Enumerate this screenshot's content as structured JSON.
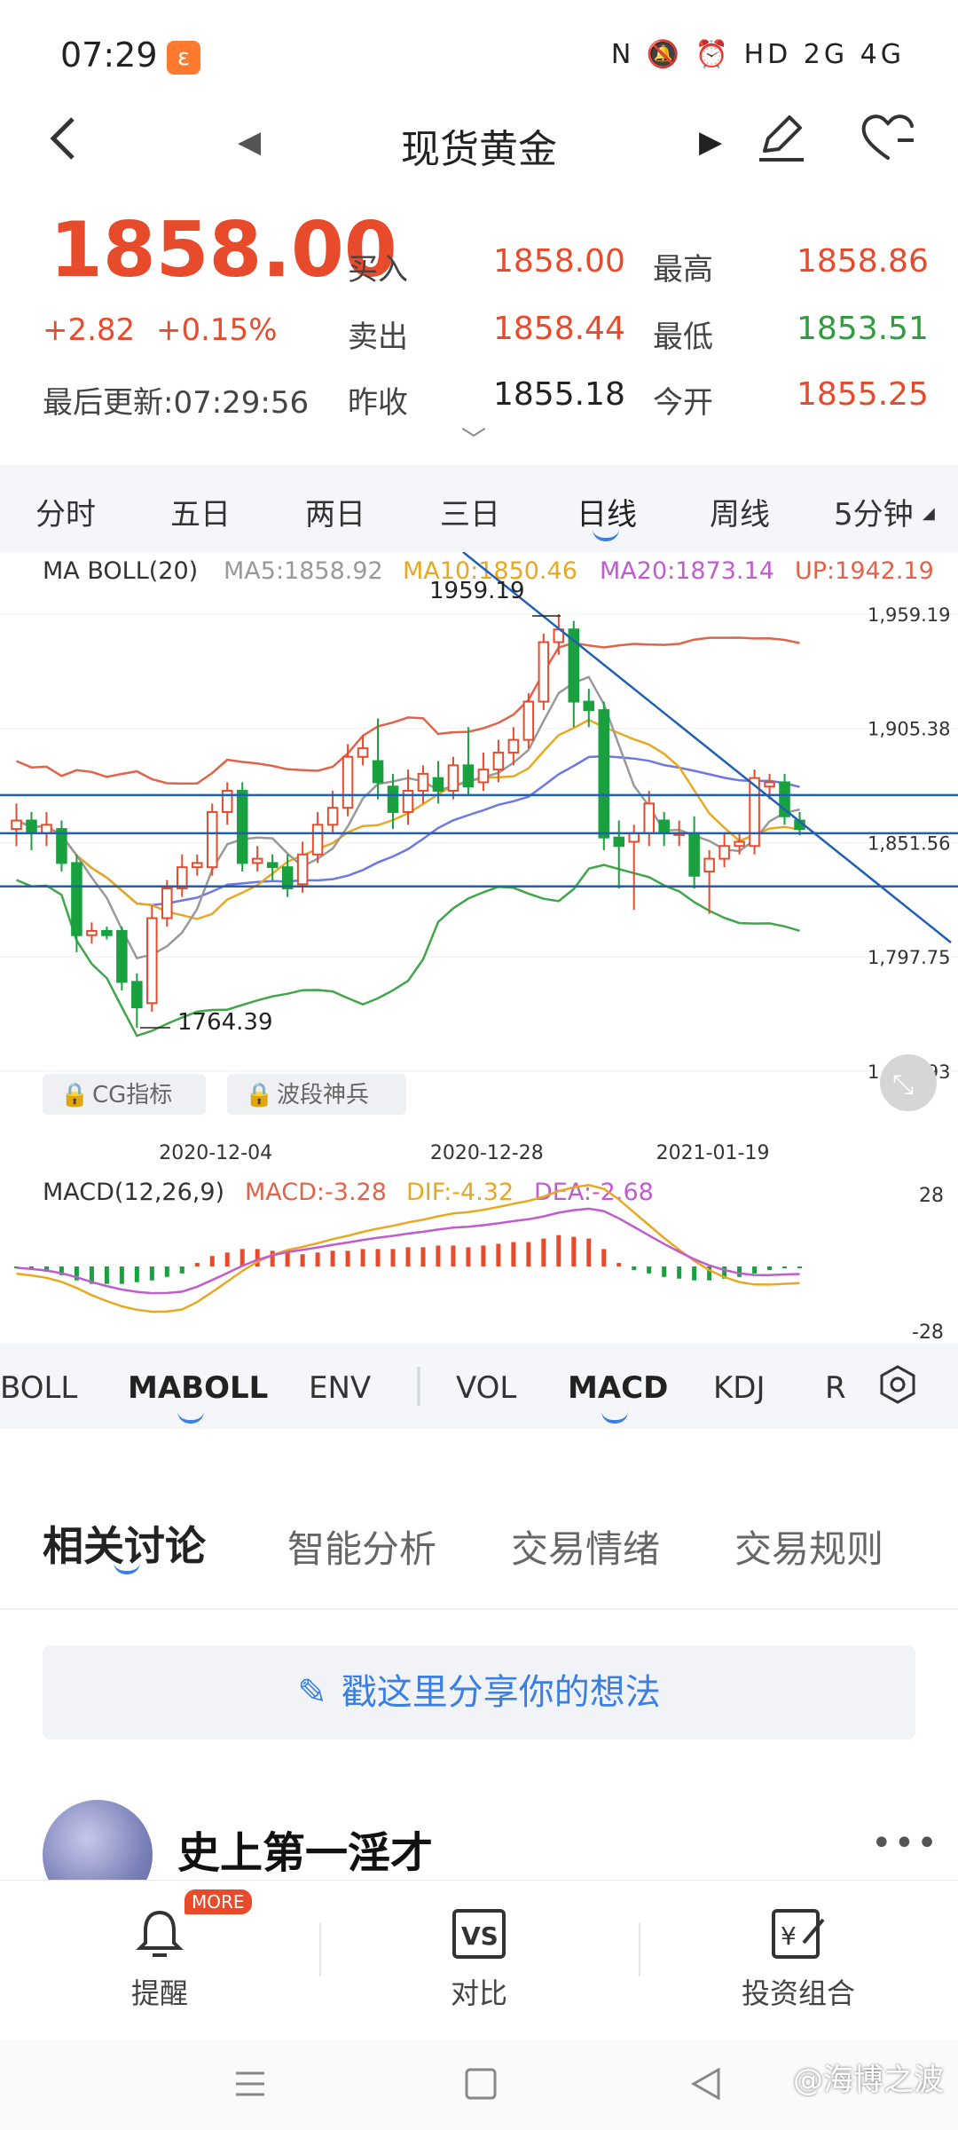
{
  "status_bar": {
    "time": "07:29",
    "app_icon": "uc-browser-icon",
    "icons_text": "N 🔕 ⏰ HD 2G 4G"
  },
  "nav": {
    "title": "现货黄金",
    "back_icon": "back-icon",
    "prev_icon": "prev-triangle-icon",
    "next_icon": "next-triangle-icon",
    "edit_icon": "edit-pen-icon",
    "fav_icon": "heart-icon"
  },
  "quote": {
    "price": "1858.00",
    "change": "+2.82",
    "change_pct": "+0.15%",
    "updated": "最后更新:07:29:56",
    "buy_label": "买入",
    "buy": "1858.00",
    "sell_label": "卖出",
    "sell": "1858.44",
    "prev_close_label": "昨收",
    "prev_close": "1855.18",
    "high_label": "最高",
    "high": "1858.86",
    "low_label": "最低",
    "low": "1853.51",
    "open_label": "今开",
    "open": "1855.25",
    "expand_icon": "chevron-down-icon"
  },
  "period_tabs": [
    "分时",
    "五日",
    "两日",
    "三日",
    "日线",
    "周线",
    "5分钟"
  ],
  "active_period": "日线",
  "chart_colors": {
    "up": "#e84b2c",
    "down": "#18a13e",
    "ma5": "#999999",
    "ma10": "#e8a820",
    "ma20": "#6b78e6",
    "upper": "#e0634a",
    "lower": "#3fa64a",
    "hline": "#1f5fb4"
  },
  "chart_header": {
    "name": "MA BOLL(20)",
    "ma5": "MA5:1858.92",
    "ma10": "MA10:1850.46",
    "ma20": "MA20:1873.14",
    "up": "UP:1942.19"
  },
  "macd_header": {
    "name": "MACD(12,26,9)",
    "macd": "MACD:-3.28",
    "dif": "DIF:-4.32",
    "dea": "DEA:-2.68"
  },
  "indicator_chips": [
    "CG指标",
    "波段神兵"
  ],
  "indicator_tabs": [
    "BOLL",
    "MABOLL",
    "ENV",
    "VOL",
    "MACD",
    "KDJ",
    "R"
  ],
  "active_indicator_tabs": [
    "MABOLL",
    "MACD"
  ],
  "discussion_tabs": [
    "相关讨论",
    "智能分析",
    "交易情绪",
    "交易规则"
  ],
  "share_prompt": "戳这里分享你的想法",
  "post": {
    "username": "史上第一淫才"
  },
  "toolbar": {
    "alert_label": "提醒",
    "badge": "MORE",
    "compare_label": "对比",
    "portfolio_label": "投资组合"
  },
  "watermark": "@海博之波",
  "chart_data": {
    "type": "candlestick",
    "y_ticks": [
      "1,959.19",
      "1,905.38",
      "1,851.56",
      "1,797.75",
      "1,743.93"
    ],
    "ylim": [
      1743.93,
      1959.19
    ],
    "x_ticks": [
      "2020-12-04",
      "2020-12-28",
      "2021-01-19"
    ],
    "max_label": "1959.19",
    "min_label": "1764.39",
    "candles": [
      {
        "o": 1858,
        "c": 1862,
        "h": 1870,
        "l": 1850
      },
      {
        "o": 1862,
        "c": 1856,
        "h": 1866,
        "l": 1848
      },
      {
        "o": 1856,
        "c": 1860,
        "h": 1866,
        "l": 1850
      },
      {
        "o": 1858,
        "c": 1842,
        "h": 1862,
        "l": 1838
      },
      {
        "o": 1842,
        "c": 1808,
        "h": 1846,
        "l": 1800
      },
      {
        "o": 1808,
        "c": 1810,
        "h": 1814,
        "l": 1804
      },
      {
        "o": 1810,
        "c": 1808,
        "h": 1812,
        "l": 1806
      },
      {
        "o": 1810,
        "c": 1786,
        "h": 1812,
        "l": 1782
      },
      {
        "o": 1786,
        "c": 1774,
        "h": 1790,
        "l": 1764.39
      },
      {
        "o": 1776,
        "c": 1816,
        "h": 1822,
        "l": 1772
      },
      {
        "o": 1816,
        "c": 1830,
        "h": 1834,
        "l": 1812
      },
      {
        "o": 1830,
        "c": 1840,
        "h": 1846,
        "l": 1826
      },
      {
        "o": 1840,
        "c": 1842,
        "h": 1846,
        "l": 1836
      },
      {
        "o": 1840,
        "c": 1866,
        "h": 1870,
        "l": 1836
      },
      {
        "o": 1866,
        "c": 1876,
        "h": 1880,
        "l": 1860
      },
      {
        "o": 1876,
        "c": 1842,
        "h": 1880,
        "l": 1838
      },
      {
        "o": 1842,
        "c": 1844,
        "h": 1850,
        "l": 1838
      },
      {
        "o": 1842,
        "c": 1840,
        "h": 1846,
        "l": 1834
      },
      {
        "o": 1840,
        "c": 1830,
        "h": 1846,
        "l": 1826
      },
      {
        "o": 1832,
        "c": 1846,
        "h": 1852,
        "l": 1828
      },
      {
        "o": 1846,
        "c": 1860,
        "h": 1866,
        "l": 1842
      },
      {
        "o": 1860,
        "c": 1868,
        "h": 1876,
        "l": 1856
      },
      {
        "o": 1868,
        "c": 1892,
        "h": 1898,
        "l": 1864
      },
      {
        "o": 1892,
        "c": 1896,
        "h": 1902,
        "l": 1888
      },
      {
        "o": 1890,
        "c": 1880,
        "h": 1910,
        "l": 1872
      },
      {
        "o": 1878,
        "c": 1866,
        "h": 1884,
        "l": 1858
      },
      {
        "o": 1866,
        "c": 1876,
        "h": 1886,
        "l": 1860
      },
      {
        "o": 1876,
        "c": 1884,
        "h": 1888,
        "l": 1870
      },
      {
        "o": 1882,
        "c": 1876,
        "h": 1890,
        "l": 1870
      },
      {
        "o": 1876,
        "c": 1888,
        "h": 1892,
        "l": 1872
      },
      {
        "o": 1888,
        "c": 1878,
        "h": 1906,
        "l": 1874
      },
      {
        "o": 1880,
        "c": 1886,
        "h": 1894,
        "l": 1876
      },
      {
        "o": 1886,
        "c": 1894,
        "h": 1900,
        "l": 1880
      },
      {
        "o": 1894,
        "c": 1900,
        "h": 1906,
        "l": 1888
      },
      {
        "o": 1900,
        "c": 1918,
        "h": 1922,
        "l": 1896
      },
      {
        "o": 1918,
        "c": 1946,
        "h": 1950,
        "l": 1914
      },
      {
        "o": 1946,
        "c": 1952,
        "h": 1959.19,
        "l": 1940
      },
      {
        "o": 1952,
        "c": 1918,
        "h": 1956,
        "l": 1906
      },
      {
        "o": 1918,
        "c": 1914,
        "h": 1924,
        "l": 1906
      },
      {
        "o": 1914,
        "c": 1854,
        "h": 1918,
        "l": 1848
      },
      {
        "o": 1854,
        "c": 1850,
        "h": 1862,
        "l": 1830
      },
      {
        "o": 1852,
        "c": 1856,
        "h": 1860,
        "l": 1820
      },
      {
        "o": 1856,
        "c": 1870,
        "h": 1876,
        "l": 1850
      },
      {
        "o": 1862,
        "c": 1856,
        "h": 1866,
        "l": 1850
      },
      {
        "o": 1856,
        "c": 1856,
        "h": 1862,
        "l": 1850
      },
      {
        "o": 1856,
        "c": 1836,
        "h": 1864,
        "l": 1830
      },
      {
        "o": 1838,
        "c": 1844,
        "h": 1848,
        "l": 1818
      },
      {
        "o": 1844,
        "c": 1850,
        "h": 1856,
        "l": 1840
      },
      {
        "o": 1850,
        "c": 1852,
        "h": 1856,
        "l": 1846
      },
      {
        "o": 1850,
        "c": 1882,
        "h": 1886,
        "l": 1846
      },
      {
        "o": 1878,
        "c": 1880,
        "h": 1884,
        "l": 1872
      },
      {
        "o": 1880,
        "c": 1864,
        "h": 1884,
        "l": 1860
      },
      {
        "o": 1862,
        "c": 1858,
        "h": 1866,
        "l": 1855
      }
    ],
    "macd_ylim": [
      -28,
      28
    ],
    "macd_ticks": [
      "28",
      "-28"
    ],
    "macd_hist": [
      -1,
      -2,
      -3,
      -5,
      -8,
      -10,
      -10,
      -10,
      -9,
      -8,
      -6,
      -4,
      2,
      6,
      8,
      10,
      10,
      9,
      8,
      7,
      8,
      9,
      9,
      10,
      10,
      10,
      11,
      11,
      12,
      12,
      11,
      12,
      13,
      14,
      14,
      16,
      18,
      17,
      16,
      10,
      2,
      -2,
      -4,
      -6,
      -7,
      -8,
      -8,
      -7,
      -6,
      -4,
      -2,
      -1,
      -1
    ]
  }
}
